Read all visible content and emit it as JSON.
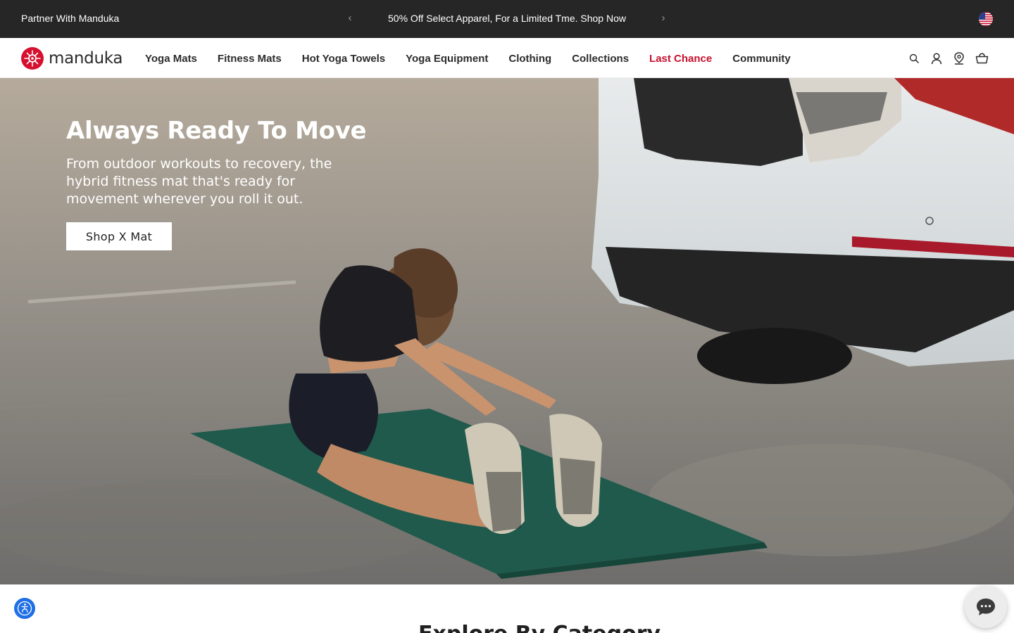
{
  "announcement": {
    "partner_link": "Partner With Manduka",
    "promo_text": "50% Off Select Apparel, For a Limited Tme. Shop Now",
    "prev_icon": "chevron-left-icon",
    "next_icon": "chevron-right-icon",
    "flag_icon": "us-flag-icon"
  },
  "header": {
    "logo_text": "manduka",
    "nav": [
      {
        "label": "Yoga Mats"
      },
      {
        "label": "Fitness Mats"
      },
      {
        "label": "Hot Yoga Towels"
      },
      {
        "label": "Yoga Equipment"
      },
      {
        "label": "Clothing"
      },
      {
        "label": "Collections"
      },
      {
        "label": "Last Chance"
      },
      {
        "label": "Community"
      }
    ],
    "icons": [
      "search-icon",
      "account-icon",
      "store-locator-icon",
      "cart-icon"
    ]
  },
  "hero": {
    "title": "Always Ready To Move",
    "subtitle": "From outdoor workouts to recovery, the hybrid fitness mat that's ready for movement wherever you roll it out.",
    "cta_label": "Shop X Mat"
  },
  "below": {
    "section_title": "Explore By Category"
  },
  "colors": {
    "announcement_bg": "#262626",
    "brand_red": "#d6102e",
    "sale_red": "#c8102e",
    "accessibility_blue": "#1f6fe5",
    "mat_green": "#1f5a4c"
  }
}
